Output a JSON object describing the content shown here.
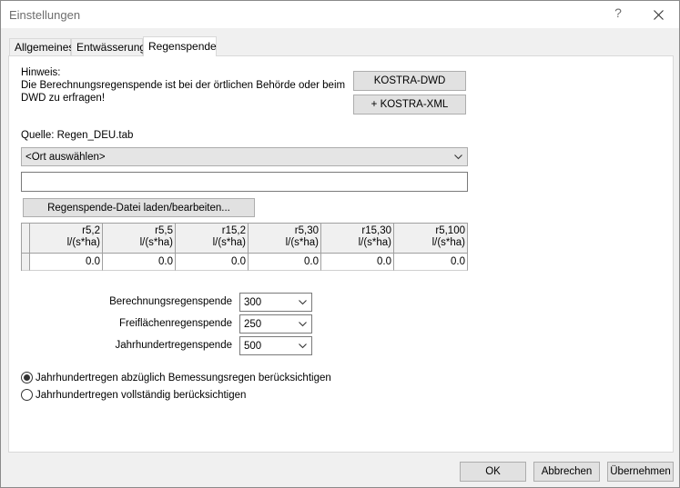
{
  "window": {
    "title": "Einstellungen",
    "help": "?"
  },
  "tabs": [
    {
      "label": "Allgemeines"
    },
    {
      "label": "Entwässerung"
    },
    {
      "label": "Regenspende"
    }
  ],
  "panel": {
    "hint_title": "Hinweis:",
    "hint_line1": "Die Berechnungsregenspende ist bei der örtlichen Behörde oder beim",
    "hint_line2": "DWD zu erfragen!",
    "kostra_dwd_label": "KOSTRA-DWD",
    "kostra_xml_label": "+ KOSTRA-XML",
    "source_label": "Quelle: Regen_DEU.tab",
    "location_combo_value": "<Ort auswählen>",
    "text_field_value": "",
    "load_file_label": "Regenspende-Datei laden/bearbeiten...",
    "grid": {
      "headers": [
        {
          "line1": "r5,2",
          "line2": "l/(s*ha)"
        },
        {
          "line1": "r5,5",
          "line2": "l/(s*ha)"
        },
        {
          "line1": "r15,2",
          "line2": "l/(s*ha)"
        },
        {
          "line1": "r5,30",
          "line2": "l/(s*ha)"
        },
        {
          "line1": "r15,30",
          "line2": "l/(s*ha)"
        },
        {
          "line1": "r5,100",
          "line2": "l/(s*ha)"
        }
      ],
      "values": [
        "0.0",
        "0.0",
        "0.0",
        "0.0",
        "0.0",
        "0.0"
      ]
    },
    "berechnung_label": "Berechnungsregenspende",
    "berechnung_value": "300",
    "freiflaechen_label": "Freiflächenregenspende",
    "freiflaechen_value": "250",
    "jahrhundert_label": "Jahrhundertregenspende",
    "jahrhundert_value": "500",
    "radio1_label": "Jahrhundertregen abzüglich Bemessungsregen berücksichtigen",
    "radio2_label": "Jahrhundertregen vollständig berücksichtigen"
  },
  "footer": {
    "ok_label": "OK",
    "cancel_label": "Abbrechen",
    "apply_label": "Übernehmen"
  }
}
